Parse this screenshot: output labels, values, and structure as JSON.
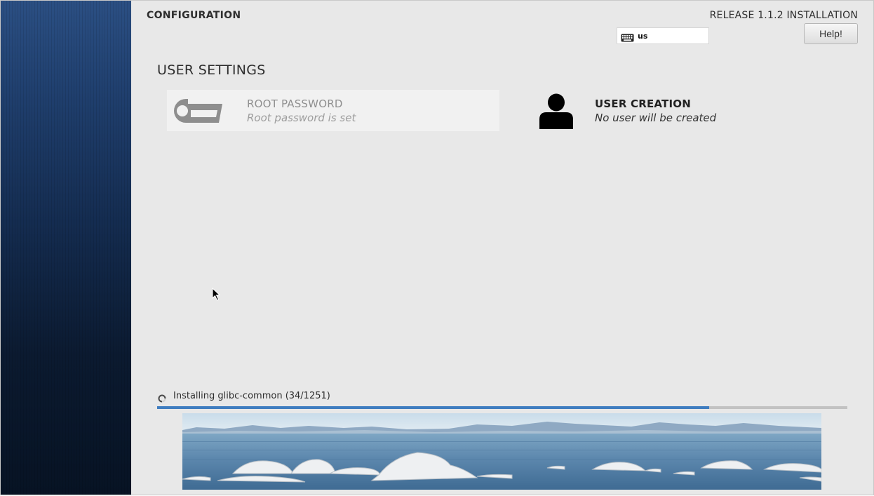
{
  "header": {
    "spoke_title": "CONFIGURATION",
    "product_title": "RELEASE 1.1.2 INSTALLATION",
    "keyboard_layout": "us",
    "help_label": "Help!"
  },
  "section": {
    "title": "USER SETTINGS"
  },
  "spokes": [
    {
      "name": "ROOT PASSWORD",
      "status": "Root password is set",
      "icon": "key-icon"
    },
    {
      "name": "USER CREATION",
      "status": "No user will be created",
      "icon": "user-icon"
    }
  ],
  "progress": {
    "text": "Installing glibc-common (34/1251)",
    "fraction": 0.8
  },
  "colors": {
    "accent": "#3f7dc0",
    "sidebar_top": "#2b4f83",
    "sidebar_bottom": "#071324"
  }
}
